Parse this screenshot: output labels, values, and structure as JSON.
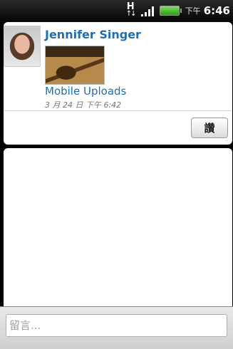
{
  "status_bar": {
    "network_label": "H",
    "time_ampm": "下午",
    "time": "6:46"
  },
  "post": {
    "author": "Jennifer Singer",
    "album": "Mobile Uploads",
    "timestamp": "3 月 24 日 下午 6:42",
    "like_label": "讚"
  },
  "comment": {
    "placeholder": "留言..."
  },
  "colors": {
    "link_blue": "#1f6fb3",
    "status_bar_bg": "#000000",
    "battery_green": "#4cc23a"
  },
  "icons": [
    "network-h-plus-icon",
    "signal-strength-icon",
    "battery-icon"
  ]
}
